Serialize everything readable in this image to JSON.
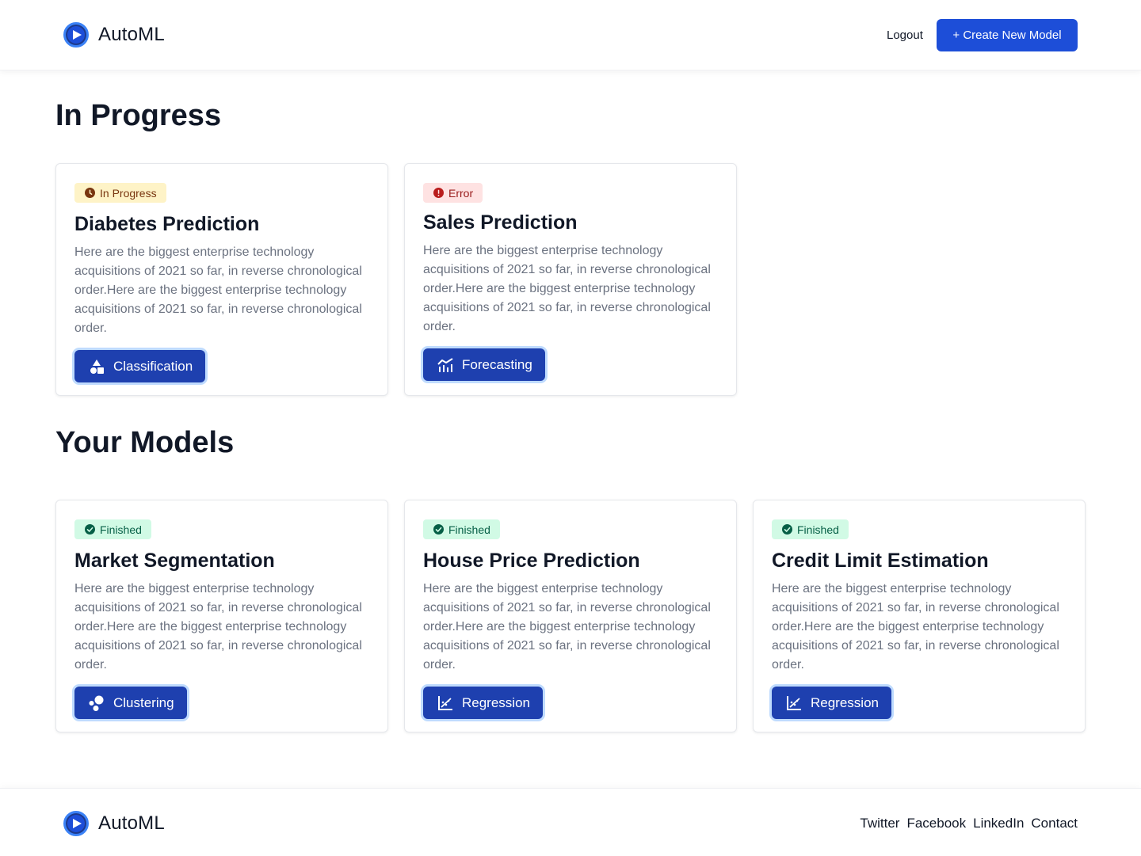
{
  "header": {
    "brand": "AutoML",
    "logout_label": "Logout",
    "create_label": "+ Create New Model"
  },
  "sections": {
    "in_progress_title": "In Progress",
    "models_title": "Your Models"
  },
  "colors": {
    "primary": "#1d4ed8",
    "type_button": "#1e40af",
    "badge_in_progress_bg": "#fef3c7",
    "badge_error_bg": "#fee2e2",
    "badge_finished_bg": "#d1fae5"
  },
  "in_progress_cards": [
    {
      "status": "In Progress",
      "status_icon": "clock-icon",
      "title": "Diabetes Prediction",
      "description": "Here are the biggest enterprise technology acquisitions of 2021 so far, in reverse chronological order.Here are the biggest enterprise technology acquisitions of 2021 so far, in reverse chronological order.",
      "type": "Classification",
      "type_icon": "shapes-icon"
    },
    {
      "status": "Error",
      "status_icon": "exclamation-icon",
      "title": "Sales Prediction",
      "description": "Here are the biggest enterprise technology acquisitions of 2021 so far, in reverse chronological order.Here are the biggest enterprise technology acquisitions of 2021 so far, in reverse chronological order.",
      "type": "Forecasting",
      "type_icon": "forecast-chart-icon"
    }
  ],
  "model_cards": [
    {
      "status": "Finished",
      "status_icon": "check-circle-icon",
      "title": "Market Segmentation",
      "description": "Here are the biggest enterprise technology acquisitions of 2021 so far, in reverse chronological order.Here are the biggest enterprise technology acquisitions of 2021 so far, in reverse chronological order.",
      "type": "Clustering",
      "type_icon": "clusters-icon"
    },
    {
      "status": "Finished",
      "status_icon": "check-circle-icon",
      "title": "House Price Prediction",
      "description": "Here are the biggest enterprise technology acquisitions of 2021 so far, in reverse chronological order.Here are the biggest enterprise technology acquisitions of 2021 so far, in reverse chronological order.",
      "type": "Regression",
      "type_icon": "regression-chart-icon"
    },
    {
      "status": "Finished",
      "status_icon": "check-circle-icon",
      "title": "Credit Limit Estimation",
      "description": "Here are the biggest enterprise technology acquisitions of 2021 so far, in reverse chronological order.Here are the biggest enterprise technology acquisitions of 2021 so far, in reverse chronological order.",
      "type": "Regression",
      "type_icon": "regression-chart-icon"
    }
  ],
  "footer": {
    "brand": "AutoML",
    "links": [
      "Twitter",
      "Facebook",
      "LinkedIn",
      "Contact"
    ]
  }
}
